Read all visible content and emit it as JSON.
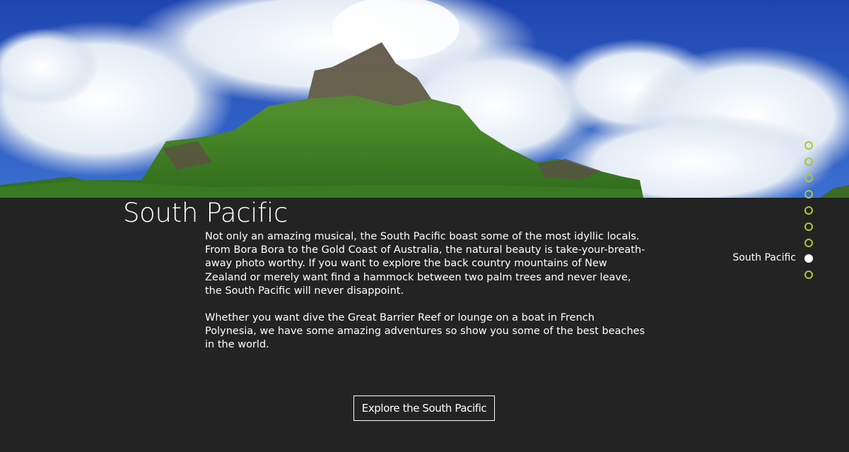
{
  "hero": {
    "image": "south-pacific-mountain-photo",
    "colors": {
      "sky": "#2650b8",
      "cloud": "#e8eef6",
      "mountain_green": "#4f8f2b",
      "rock": "#5d5348"
    }
  },
  "section": {
    "title": "South Pacific",
    "paragraphs": [
      "Not only an amazing musical, the South Pacific boast some of the most idyllic locals. From Bora Bora to the Gold Coast of Australia, the natural beauty is take-your-breath-away photo worthy. If you want to explore the back country mountains of New Zealand or merely want find a hammock between two palm trees and never leave, the South Pacific will never disappoint.",
      "Whether you want dive the Great Barrier Reef or lounge on a boat in French Polynesia, we have some amazing adventures so show you some of the best beaches in the world."
    ],
    "cta_label": "Explore the South Pacific"
  },
  "dot_nav": {
    "active_label": "South Pacific",
    "dot_count": 9,
    "active_index": 7,
    "colors": {
      "inactive": "#a8c83a",
      "active": "#ffffff"
    }
  },
  "theme": {
    "background": "#232323",
    "text": "#ffffff"
  }
}
